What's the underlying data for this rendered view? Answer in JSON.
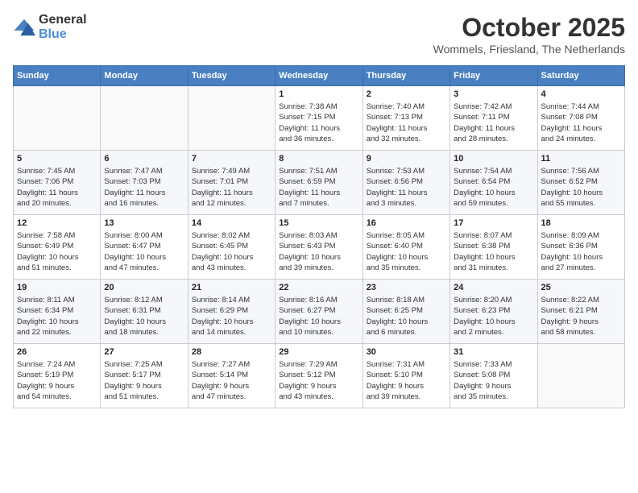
{
  "logo": {
    "general": "General",
    "blue": "Blue"
  },
  "title": "October 2025",
  "location": "Wommels, Friesland, The Netherlands",
  "days_of_week": [
    "Sunday",
    "Monday",
    "Tuesday",
    "Wednesday",
    "Thursday",
    "Friday",
    "Saturday"
  ],
  "weeks": [
    [
      {
        "day": "",
        "info": ""
      },
      {
        "day": "",
        "info": ""
      },
      {
        "day": "",
        "info": ""
      },
      {
        "day": "1",
        "info": "Sunrise: 7:38 AM\nSunset: 7:15 PM\nDaylight: 11 hours\nand 36 minutes."
      },
      {
        "day": "2",
        "info": "Sunrise: 7:40 AM\nSunset: 7:13 PM\nDaylight: 11 hours\nand 32 minutes."
      },
      {
        "day": "3",
        "info": "Sunrise: 7:42 AM\nSunset: 7:11 PM\nDaylight: 11 hours\nand 28 minutes."
      },
      {
        "day": "4",
        "info": "Sunrise: 7:44 AM\nSunset: 7:08 PM\nDaylight: 11 hours\nand 24 minutes."
      }
    ],
    [
      {
        "day": "5",
        "info": "Sunrise: 7:45 AM\nSunset: 7:06 PM\nDaylight: 11 hours\nand 20 minutes."
      },
      {
        "day": "6",
        "info": "Sunrise: 7:47 AM\nSunset: 7:03 PM\nDaylight: 11 hours\nand 16 minutes."
      },
      {
        "day": "7",
        "info": "Sunrise: 7:49 AM\nSunset: 7:01 PM\nDaylight: 11 hours\nand 12 minutes."
      },
      {
        "day": "8",
        "info": "Sunrise: 7:51 AM\nSunset: 6:59 PM\nDaylight: 11 hours\nand 7 minutes."
      },
      {
        "day": "9",
        "info": "Sunrise: 7:53 AM\nSunset: 6:56 PM\nDaylight: 11 hours\nand 3 minutes."
      },
      {
        "day": "10",
        "info": "Sunrise: 7:54 AM\nSunset: 6:54 PM\nDaylight: 10 hours\nand 59 minutes."
      },
      {
        "day": "11",
        "info": "Sunrise: 7:56 AM\nSunset: 6:52 PM\nDaylight: 10 hours\nand 55 minutes."
      }
    ],
    [
      {
        "day": "12",
        "info": "Sunrise: 7:58 AM\nSunset: 6:49 PM\nDaylight: 10 hours\nand 51 minutes."
      },
      {
        "day": "13",
        "info": "Sunrise: 8:00 AM\nSunset: 6:47 PM\nDaylight: 10 hours\nand 47 minutes."
      },
      {
        "day": "14",
        "info": "Sunrise: 8:02 AM\nSunset: 6:45 PM\nDaylight: 10 hours\nand 43 minutes."
      },
      {
        "day": "15",
        "info": "Sunrise: 8:03 AM\nSunset: 6:43 PM\nDaylight: 10 hours\nand 39 minutes."
      },
      {
        "day": "16",
        "info": "Sunrise: 8:05 AM\nSunset: 6:40 PM\nDaylight: 10 hours\nand 35 minutes."
      },
      {
        "day": "17",
        "info": "Sunrise: 8:07 AM\nSunset: 6:38 PM\nDaylight: 10 hours\nand 31 minutes."
      },
      {
        "day": "18",
        "info": "Sunrise: 8:09 AM\nSunset: 6:36 PM\nDaylight: 10 hours\nand 27 minutes."
      }
    ],
    [
      {
        "day": "19",
        "info": "Sunrise: 8:11 AM\nSunset: 6:34 PM\nDaylight: 10 hours\nand 22 minutes."
      },
      {
        "day": "20",
        "info": "Sunrise: 8:12 AM\nSunset: 6:31 PM\nDaylight: 10 hours\nand 18 minutes."
      },
      {
        "day": "21",
        "info": "Sunrise: 8:14 AM\nSunset: 6:29 PM\nDaylight: 10 hours\nand 14 minutes."
      },
      {
        "day": "22",
        "info": "Sunrise: 8:16 AM\nSunset: 6:27 PM\nDaylight: 10 hours\nand 10 minutes."
      },
      {
        "day": "23",
        "info": "Sunrise: 8:18 AM\nSunset: 6:25 PM\nDaylight: 10 hours\nand 6 minutes."
      },
      {
        "day": "24",
        "info": "Sunrise: 8:20 AM\nSunset: 6:23 PM\nDaylight: 10 hours\nand 2 minutes."
      },
      {
        "day": "25",
        "info": "Sunrise: 8:22 AM\nSunset: 6:21 PM\nDaylight: 9 hours\nand 58 minutes."
      }
    ],
    [
      {
        "day": "26",
        "info": "Sunrise: 7:24 AM\nSunset: 5:19 PM\nDaylight: 9 hours\nand 54 minutes."
      },
      {
        "day": "27",
        "info": "Sunrise: 7:25 AM\nSunset: 5:17 PM\nDaylight: 9 hours\nand 51 minutes."
      },
      {
        "day": "28",
        "info": "Sunrise: 7:27 AM\nSunset: 5:14 PM\nDaylight: 9 hours\nand 47 minutes."
      },
      {
        "day": "29",
        "info": "Sunrise: 7:29 AM\nSunset: 5:12 PM\nDaylight: 9 hours\nand 43 minutes."
      },
      {
        "day": "30",
        "info": "Sunrise: 7:31 AM\nSunset: 5:10 PM\nDaylight: 9 hours\nand 39 minutes."
      },
      {
        "day": "31",
        "info": "Sunrise: 7:33 AM\nSunset: 5:08 PM\nDaylight: 9 hours\nand 35 minutes."
      },
      {
        "day": "",
        "info": ""
      }
    ]
  ]
}
